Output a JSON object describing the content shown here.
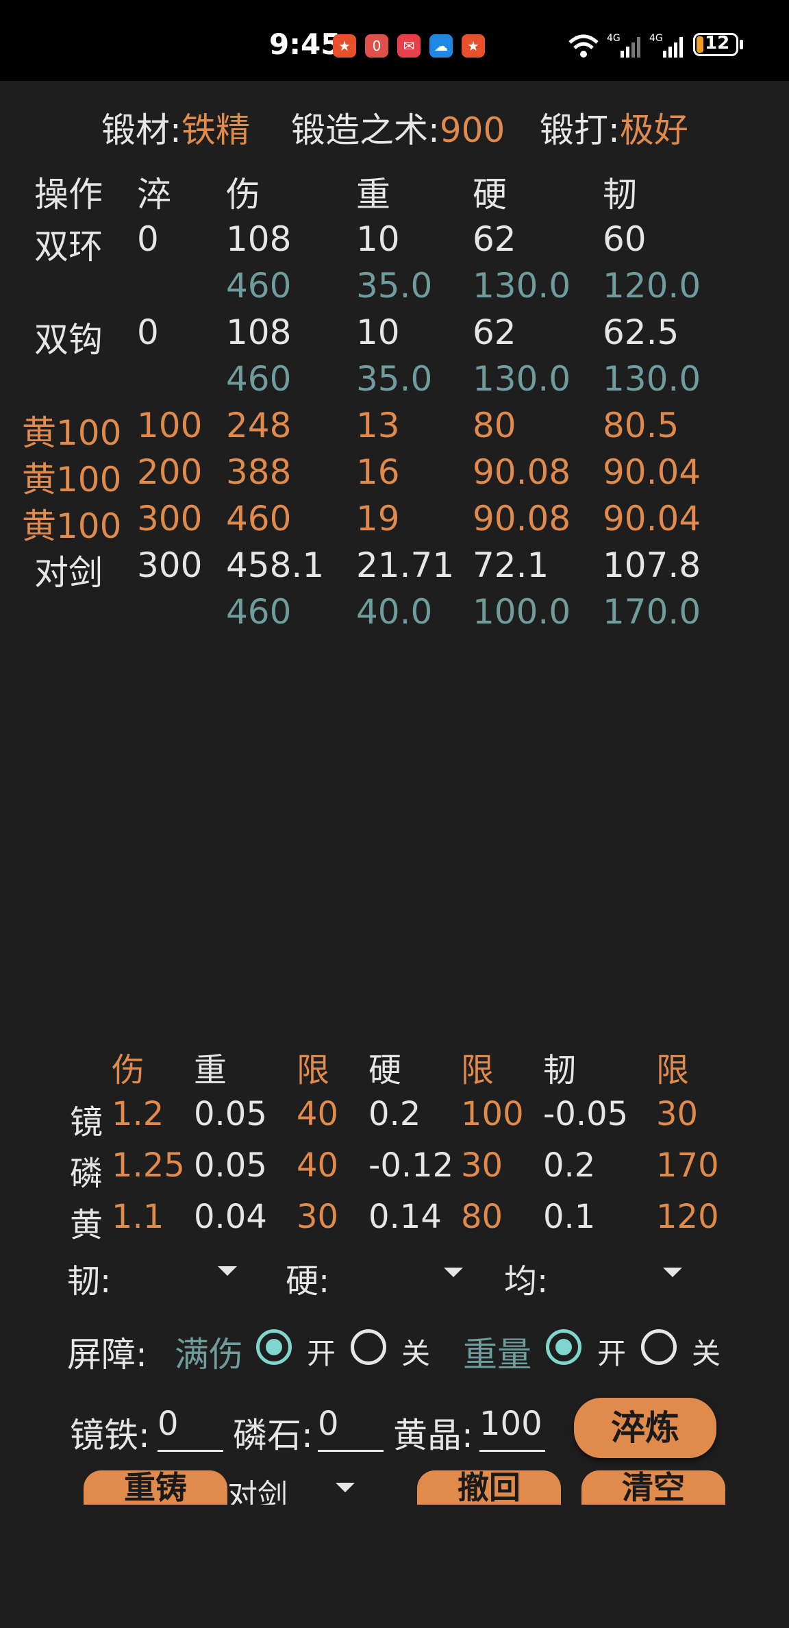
{
  "status_bar": {
    "time": "9:45",
    "battery": "12"
  },
  "header": {
    "material_label": "锻材:",
    "material_value": "铁精",
    "skill_label": "锻造之术:",
    "skill_value": "900",
    "forge_label": "锻打:",
    "forge_value": "极好"
  },
  "table": {
    "headers": [
      "操作",
      "淬",
      "伤",
      "重",
      "硬",
      "韧"
    ],
    "rows": [
      {
        "op": "双环",
        "c": "0",
        "shang": "108",
        "zhong": "10",
        "ying": "62",
        "ren": "60",
        "style": "white"
      },
      {
        "op": "",
        "c": "",
        "shang": "460",
        "zhong": "35.0",
        "ying": "130.0",
        "ren": "120.0",
        "style": "teal"
      },
      {
        "op": "双钩",
        "c": "0",
        "shang": "108",
        "zhong": "10",
        "ying": "62",
        "ren": "62.5",
        "style": "white"
      },
      {
        "op": "",
        "c": "",
        "shang": "460",
        "zhong": "35.0",
        "ying": "130.0",
        "ren": "130.0",
        "style": "teal"
      },
      {
        "op": "黄100",
        "c": "100",
        "shang": "248",
        "zhong": "13",
        "ying": "80",
        "ren": "80.5",
        "style": "orange"
      },
      {
        "op": "黄100",
        "c": "200",
        "shang": "388",
        "zhong": "16",
        "ying": "90.08",
        "ren": "90.04",
        "style": "orange"
      },
      {
        "op": "黄100",
        "c": "300",
        "shang": "460",
        "zhong": "19",
        "ying": "90.08",
        "ren": "90.04",
        "style": "orange"
      },
      {
        "op": "对剑",
        "c": "300",
        "shang": "458.1",
        "zhong": "21.71",
        "ying": "72.1",
        "ren": "107.8",
        "style": "white"
      },
      {
        "op": "",
        "c": "",
        "shang": "460",
        "zhong": "40.0",
        "ying": "100.0",
        "ren": "170.0",
        "style": "teal"
      }
    ]
  },
  "coef": {
    "headers": [
      "伤",
      "重",
      "限",
      "硬",
      "限",
      "韧",
      "限"
    ],
    "rows": [
      {
        "name": "镜",
        "vals": [
          "1.2",
          "0.05",
          "40",
          "0.2",
          "100",
          "-0.05",
          "30"
        ]
      },
      {
        "name": "磷",
        "vals": [
          "1.25",
          "0.05",
          "40",
          "-0.12",
          "30",
          "0.2",
          "170"
        ]
      },
      {
        "name": "黄",
        "vals": [
          "1.1",
          "0.04",
          "30",
          "0.14",
          "80",
          "0.1",
          "120"
        ]
      }
    ]
  },
  "selects": {
    "ren_label": "韧:",
    "ying_label": "硬:",
    "jun_label": "均:"
  },
  "barrier": {
    "label": "屏障:",
    "full_damage": "满伤",
    "weight": "重量",
    "on": "开",
    "off": "关",
    "full_damage_on": true,
    "weight_on": true
  },
  "inputs": {
    "jingtie_label": "镜铁:",
    "jingtie_value": "0",
    "linshi_label": "磷石:",
    "linshi_value": "0",
    "huangjing_label": "黄晶:",
    "huangjing_value": "100"
  },
  "buttons": {
    "cuilian": "淬炼",
    "chongzhu": "重铸",
    "chehui": "撤回",
    "qingkong": "清空"
  },
  "weapon_select": {
    "value": "对剑"
  },
  "colors": {
    "accent": "#e08a4c",
    "teal": "#6f9c9c",
    "radio": "#7fd6cc",
    "background": "#1e1e1e"
  }
}
